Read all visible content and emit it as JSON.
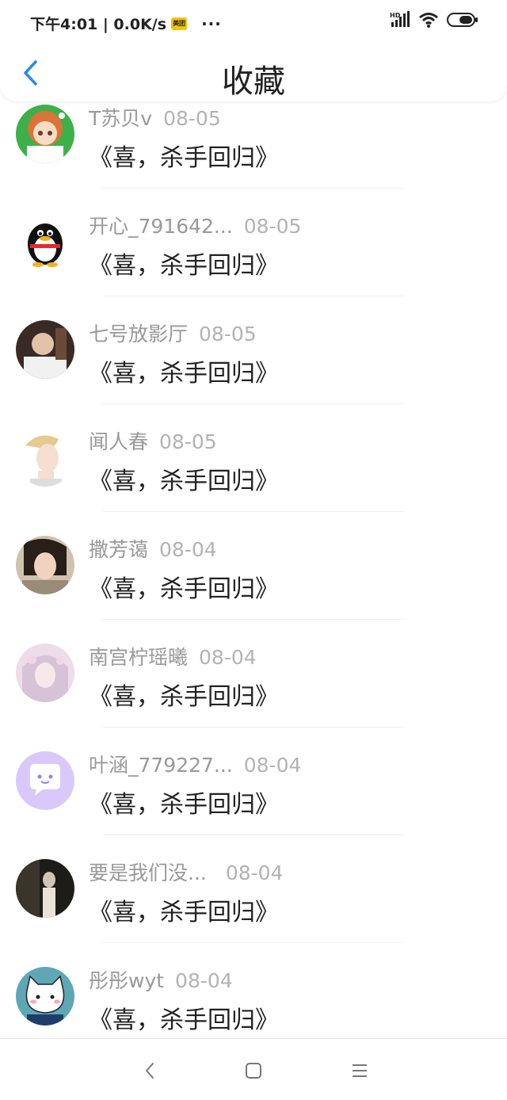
{
  "statusbar": {
    "time_speed": "下午4:01 | 0.0K/s",
    "app_icon_label": "美团",
    "more": "···",
    "signal_label": "HD"
  },
  "header": {
    "back_icon": "chevron-left-icon",
    "title": "收藏"
  },
  "colors": {
    "accent": "#2a8ae6",
    "name_text": "#999999",
    "date_text": "#b3b3b3"
  },
  "items": [
    {
      "name": "T苏贝v",
      "date": "08-05",
      "title": "《喜，杀手回归》",
      "avatar": "anime-girl-avatar"
    },
    {
      "name": "开心_791642...",
      "date": "08-05",
      "title": "《喜，杀手回归》",
      "avatar": "penguin-avatar"
    },
    {
      "name": "七号放影厅",
      "date": "08-05",
      "title": "《喜，杀手回归》",
      "avatar": "photo-avatar"
    },
    {
      "name": "闻人春",
      "date": "08-05",
      "title": "《喜，杀手回归》",
      "avatar": "illustration-avatar"
    },
    {
      "name": "撒芳蔼",
      "date": "08-04",
      "title": "《喜，杀手回归》",
      "avatar": "photo-avatar"
    },
    {
      "name": "南宫柠瑶曦",
      "date": "08-04",
      "title": "《喜，杀手回归》",
      "avatar": "illustration-avatar"
    },
    {
      "name": "叶涵_779227...",
      "date": "08-04",
      "title": "《喜，杀手回归》",
      "avatar": "chat-bubble-avatar"
    },
    {
      "name": "要是我们没...",
      "date": "08-04",
      "title": "《喜，杀手回归》",
      "avatar": "photo-avatar"
    },
    {
      "name": "彤彤wyt",
      "date": "08-04",
      "title": "《喜，杀手回归》",
      "avatar": "cat-avatar"
    }
  ],
  "navbar": {
    "back": "back-nav-icon",
    "home": "home-nav-icon",
    "menu": "menu-nav-icon"
  }
}
